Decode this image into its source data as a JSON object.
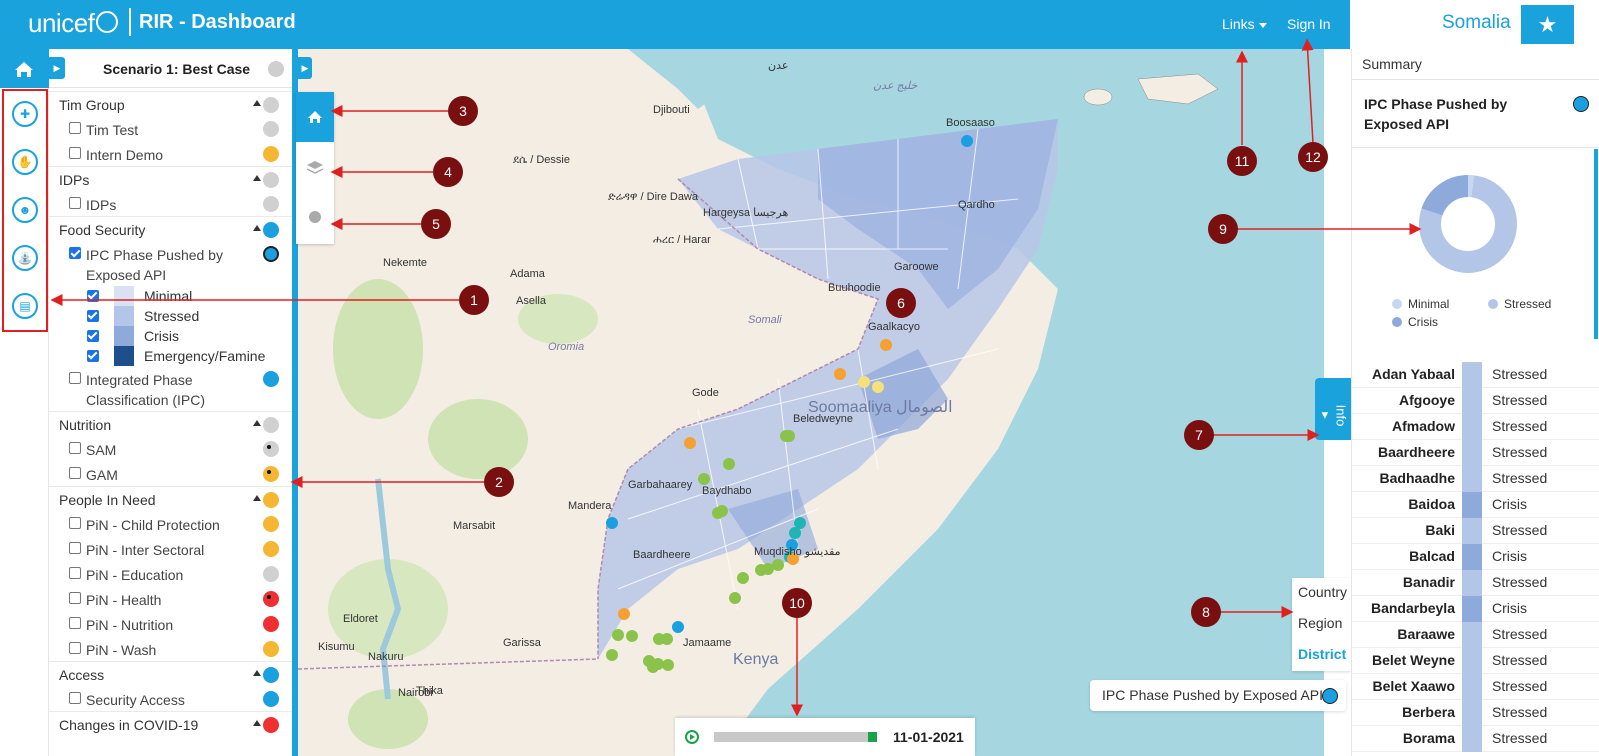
{
  "header": {
    "brand": "unicef",
    "title": "RIR - Dashboard",
    "links_label": "Links",
    "signin_label": "Sign In",
    "country": "Somalia",
    "star": "★"
  },
  "rail": {
    "icons": [
      "health-icon",
      "child-protection-icon",
      "nutrition-icon",
      "wash-icon",
      "education-icon"
    ]
  },
  "panel": {
    "scenario": "Scenario 1: Best Case",
    "groups": [
      {
        "label": "Tim Group",
        "dot": "#d0d0d0",
        "items": [
          {
            "label": "Tim Test",
            "dot": "#d0d0d0",
            "checked": false
          },
          {
            "label": "Intern Demo",
            "dot": "#f5b731",
            "checked": false
          }
        ]
      },
      {
        "label": "IDPs",
        "dot": "#d0d0d0",
        "items": [
          {
            "label": "IDPs",
            "dot": "#d0d0d0",
            "checked": false
          }
        ]
      },
      {
        "label": "Food Security",
        "dot": "#1a9fe0",
        "items": [
          {
            "label": "IPC Phase Pushed by Exposed API",
            "dot": "#1a9fe0",
            "checked": true
          },
          {
            "label": "Integrated Phase Classification (IPC)",
            "dot": "#1a9fe0",
            "checked": false
          }
        ],
        "legend": [
          {
            "label": "Minimal",
            "color": "#d9e2f3"
          },
          {
            "label": "Stressed",
            "color": "#b3c6e7"
          },
          {
            "label": "Crisis",
            "color": "#8eaadb"
          },
          {
            "label": "Emergency/Famine",
            "color": "#1f4e8c"
          }
        ]
      },
      {
        "label": "Nutrition",
        "dot": "#d0d0d0",
        "items": [
          {
            "label": "SAM",
            "dot": "#d0d0d0",
            "checked": false
          },
          {
            "label": "GAM",
            "dot": "#f5b731",
            "checked": false
          }
        ]
      },
      {
        "label": "People In Need",
        "dot": "#f5b731",
        "items": [
          {
            "label": "PiN - Child Protection",
            "dot": "#f5b731",
            "checked": false
          },
          {
            "label": "PiN - Inter Sectoral",
            "dot": "#f5b731",
            "checked": false
          },
          {
            "label": "PiN - Education",
            "dot": "#d0d0d0",
            "checked": false
          },
          {
            "label": "PiN - Health",
            "dot": "#ee3030",
            "checked": false
          },
          {
            "label": "PiN - Nutrition",
            "dot": "#ee3030",
            "checked": false
          },
          {
            "label": "PiN - Wash",
            "dot": "#f5b731",
            "checked": false
          }
        ]
      },
      {
        "label": "Access",
        "dot": "#1a9fe0",
        "items": [
          {
            "label": "Security Access",
            "dot": "#1a9fe0",
            "checked": false
          }
        ]
      },
      {
        "label": "Changes in COVID-19",
        "dot": "#ee3030",
        "items": []
      }
    ]
  },
  "map": {
    "levels": [
      "Country",
      "Region",
      "District"
    ],
    "active_level": "District",
    "active_layer": "IPC Phase Pushed by Exposed API",
    "info_tab": "Info ▸",
    "labels": [
      {
        "text": "Djibouti",
        "k": "city"
      },
      {
        "text": "Hargeysa هرجيسا",
        "k": "city"
      },
      {
        "text": "Boosaaso",
        "k": "city"
      },
      {
        "text": "Qardho",
        "k": "city"
      },
      {
        "text": "Garoowe",
        "k": "city"
      },
      {
        "text": "Buuhoodie",
        "k": "city"
      },
      {
        "text": "Gaalkacyo",
        "k": "city"
      },
      {
        "text": "Soomaaliya الصومال",
        "k": "country"
      },
      {
        "text": "Beledweyne",
        "k": "city"
      },
      {
        "text": "Baydhabo",
        "k": "city"
      },
      {
        "text": "Muqdisho مقديشو",
        "k": "city"
      },
      {
        "text": "Garbahaarey",
        "k": "city"
      },
      {
        "text": "Baardheere",
        "k": "city"
      },
      {
        "text": "Jamaame",
        "k": "city"
      },
      {
        "text": "ድሬዳዋ / Dire Dawa",
        "k": "city"
      },
      {
        "text": "ደሴ / Dessie",
        "k": "city"
      },
      {
        "text": "ሐረር / Harar",
        "k": "city"
      },
      {
        "text": "Adama",
        "k": "city"
      },
      {
        "text": "Asella",
        "k": "city"
      },
      {
        "text": "Nekemte",
        "k": "city"
      },
      {
        "text": "Gode",
        "k": "city"
      },
      {
        "text": "Kenya",
        "k": "country"
      },
      {
        "text": "Nairobi",
        "k": "city"
      },
      {
        "text": "Kisumu",
        "k": "city"
      },
      {
        "text": "Nakuru",
        "k": "city"
      },
      {
        "text": "Garissa",
        "k": "city"
      },
      {
        "text": "Eldoret",
        "k": "city"
      },
      {
        "text": "Mandera",
        "k": "city"
      },
      {
        "text": "Marsabit",
        "k": "city"
      },
      {
        "text": "Thika",
        "k": "city"
      },
      {
        "text": "خليج عدن",
        "k": "sea"
      },
      {
        "text": "عدن",
        "k": "city"
      },
      {
        "text": "Somali",
        "k": "region"
      },
      {
        "text": "Oromia",
        "k": "region"
      }
    ]
  },
  "timeline": {
    "date": "11-01-2021",
    "progress": 1.0
  },
  "summary": {
    "title": "Summary",
    "layer": "IPC Phase Pushed by Exposed API",
    "pie_legend": [
      {
        "label": "Minimal",
        "color": "#c5d7f2"
      },
      {
        "label": "Stressed",
        "color": "#b3c6e7"
      },
      {
        "label": "Crisis",
        "color": "#8eaadb"
      }
    ],
    "pie_values": [
      0.02,
      0.78,
      0.2
    ],
    "districts": [
      {
        "name": "Adan Yabaal",
        "phase": "Stressed"
      },
      {
        "name": "Afgooye",
        "phase": "Stressed"
      },
      {
        "name": "Afmadow",
        "phase": "Stressed"
      },
      {
        "name": "Baardheere",
        "phase": "Stressed"
      },
      {
        "name": "Badhaadhe",
        "phase": "Stressed"
      },
      {
        "name": "Baidoa",
        "phase": "Crisis"
      },
      {
        "name": "Baki",
        "phase": "Stressed"
      },
      {
        "name": "Balcad",
        "phase": "Crisis"
      },
      {
        "name": "Banadir",
        "phase": "Stressed"
      },
      {
        "name": "Bandarbeyla",
        "phase": "Crisis"
      },
      {
        "name": "Baraawe",
        "phase": "Stressed"
      },
      {
        "name": "Belet Weyne",
        "phase": "Stressed"
      },
      {
        "name": "Belet Xaawo",
        "phase": "Stressed"
      },
      {
        "name": "Berbera",
        "phase": "Stressed"
      },
      {
        "name": "Borama",
        "phase": "Stressed"
      }
    ]
  },
  "annotations": [
    "1",
    "2",
    "3",
    "4",
    "5",
    "6",
    "7",
    "8",
    "9",
    "10",
    "11",
    "12"
  ]
}
